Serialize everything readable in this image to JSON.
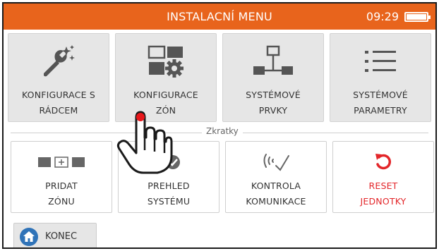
{
  "header": {
    "title": "INSTALACNÍ MENU",
    "time": "09:29",
    "battery_icon": "battery-full-icon"
  },
  "tiles": [
    {
      "icon": "wrench-magic-icon",
      "line1": "KONFIGURACE S",
      "line2": "RÁDCEM"
    },
    {
      "icon": "zone-config-gear-icon",
      "line1": "KONFIGURACE",
      "line2": "ZÓN"
    },
    {
      "icon": "network-hierarchy-icon",
      "line1": "SYSTÉMOVÉ",
      "line2": "PRVKY"
    },
    {
      "icon": "list-icon",
      "line1": "SYSTÉMOVÉ",
      "line2": "PARAMETRY"
    }
  ],
  "shortcuts_label": "Zkratky",
  "shortcuts": [
    {
      "icon": "add-zone-icon",
      "line1": "PRIDAT",
      "line2": "ZÓNU"
    },
    {
      "icon": "system-overview-icon",
      "line1": "PREHLED",
      "line2": "SYSTÉMU"
    },
    {
      "icon": "signal-communication-icon",
      "line1": "KONTROLA",
      "line2": "KOMUNIKACE"
    },
    {
      "icon": "reset-icon",
      "line1": "RESET",
      "line2": "JEDNOTKY"
    }
  ],
  "home_button": {
    "icon": "home-icon",
    "label": "KONEC"
  },
  "colors": {
    "header": "#e8641c",
    "tile_bg": "#e6e6e6",
    "reset_red": "#e3262a",
    "home_blue": "#2f73b8",
    "pointer_red": "#e8171b"
  },
  "cursor_icon": "hand-pointer-icon"
}
